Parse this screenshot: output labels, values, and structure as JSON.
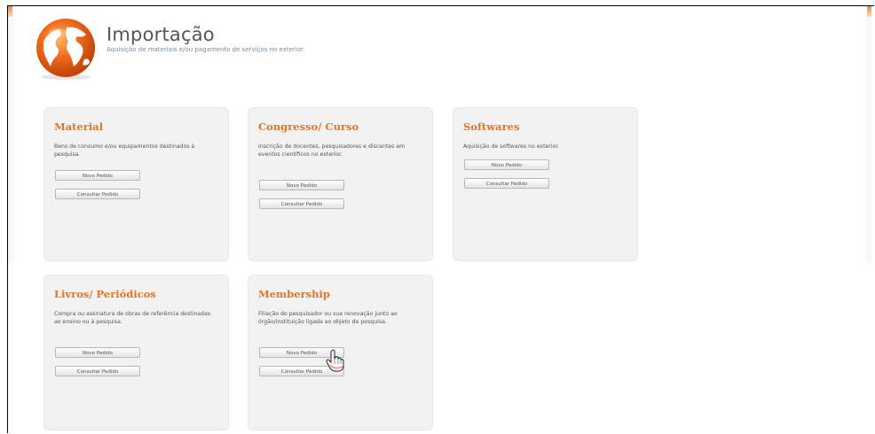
{
  "header": {
    "title": "Importação",
    "subtitle": "Aquisição de materiais e/ou pagamento de serviços no exterior."
  },
  "cards": [
    {
      "title": "Material",
      "description": "Bens de consumo e/ou equipamentos destinados à pesquisa.",
      "new_label": "Novo Pedido",
      "consult_label": "Consultar Pedido"
    },
    {
      "title": "Congresso/ Curso",
      "description": "Inscrição de docentes, pesquisadores e discentes em eventos científicos no exterior.",
      "new_label": "Novo Pedido",
      "consult_label": "Consultar Pedido"
    },
    {
      "title": "Softwares",
      "description": "Aquisição de softwares no exterior.",
      "new_label": "Novo Pedido",
      "consult_label": "Consultar Pedido"
    },
    {
      "title": "Livros/ Periódicos",
      "description": "Compra ou assinatura de obras de referência destinadas ao ensino ou à pesquisa.",
      "new_label": "Novo Pedido",
      "consult_label": "Consultar Pedido"
    },
    {
      "title": "Membership",
      "description": "Filiação do pesquisador ou sua renovação junto ao órgão/instituição ligada ao objeto de pesquisa.",
      "new_label": "Novo Pedido",
      "consult_label": "Consultar Pedido"
    }
  ],
  "colors": {
    "accent": "#e0762a",
    "card_bg": "#f2f2f2"
  },
  "icons": {
    "logo": "globe-icon",
    "pointer": "hand-cursor-icon"
  }
}
